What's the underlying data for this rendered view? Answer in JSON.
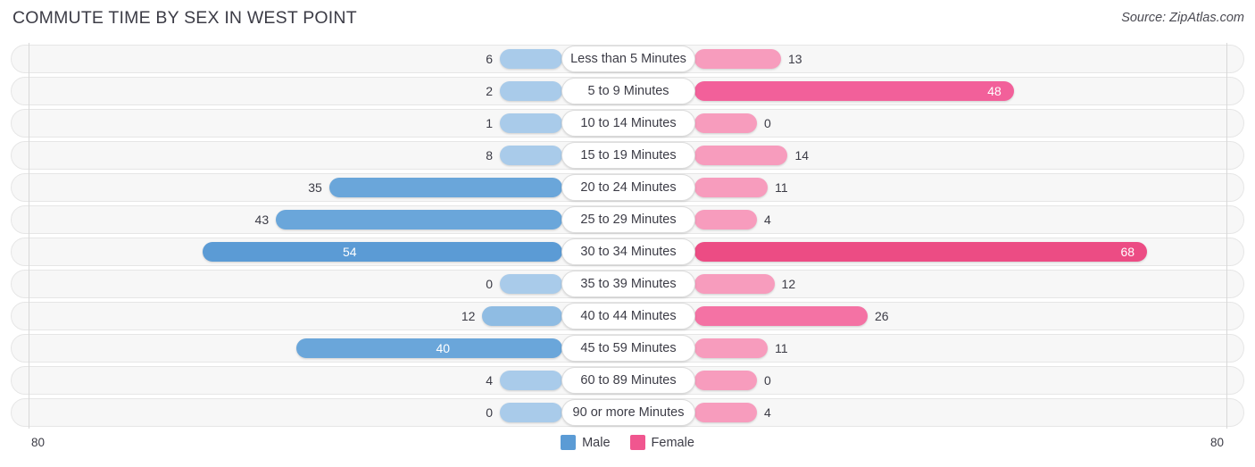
{
  "header": {
    "title": "COMMUTE TIME BY SEX IN WEST POINT",
    "source": "Source: ZipAtlas.com"
  },
  "footer": {
    "axis_left": "80",
    "axis_right": "80"
  },
  "legend": [
    {
      "label": "Male",
      "color": "#5b9bd5"
    },
    {
      "label": "Female",
      "color": "#f0568f"
    }
  ],
  "chart_data": {
    "type": "bar",
    "subtype": "diverging-bidirectional-bar",
    "title": "COMMUTE TIME BY SEX IN WEST POINT",
    "source": "Source: ZipAtlas.com",
    "xlabel": "",
    "ylabel": "",
    "xlim": [
      80,
      80
    ],
    "axis_left_max": 80,
    "axis_right_max": 80,
    "grid": false,
    "legend_position": "bottom-center",
    "categories": [
      "Less than 5 Minutes",
      "5 to 9 Minutes",
      "10 to 14 Minutes",
      "15 to 19 Minutes",
      "20 to 24 Minutes",
      "25 to 29 Minutes",
      "30 to 34 Minutes",
      "35 to 39 Minutes",
      "40 to 44 Minutes",
      "45 to 59 Minutes",
      "60 to 89 Minutes",
      "90 or more Minutes"
    ],
    "series": [
      {
        "name": "Male",
        "color": "#5b9bd5",
        "values": [
          6,
          2,
          1,
          8,
          35,
          43,
          54,
          0,
          12,
          40,
          4,
          0
        ]
      },
      {
        "name": "Female",
        "color": "#f0568f",
        "values": [
          13,
          48,
          0,
          14,
          11,
          4,
          68,
          12,
          26,
          11,
          0,
          4
        ]
      }
    ]
  },
  "rows": [
    {
      "label": "Less than 5 Minutes",
      "male": "6",
      "female": "13",
      "male_inside": false,
      "female_inside": false
    },
    {
      "label": "5 to 9 Minutes",
      "male": "2",
      "female": "48",
      "male_inside": false,
      "female_inside": true
    },
    {
      "label": "10 to 14 Minutes",
      "male": "1",
      "female": "0",
      "male_inside": false,
      "female_inside": false
    },
    {
      "label": "15 to 19 Minutes",
      "male": "8",
      "female": "14",
      "male_inside": false,
      "female_inside": false
    },
    {
      "label": "20 to 24 Minutes",
      "male": "35",
      "female": "11",
      "male_inside": false,
      "female_inside": false
    },
    {
      "label": "25 to 29 Minutes",
      "male": "43",
      "female": "4",
      "male_inside": false,
      "female_inside": false
    },
    {
      "label": "30 to 34 Minutes",
      "male": "54",
      "female": "68",
      "male_inside": true,
      "female_inside": true
    },
    {
      "label": "35 to 39 Minutes",
      "male": "0",
      "female": "12",
      "male_inside": false,
      "female_inside": false
    },
    {
      "label": "40 to 44 Minutes",
      "male": "12",
      "female": "26",
      "male_inside": false,
      "female_inside": false
    },
    {
      "label": "45 to 59 Minutes",
      "male": "40",
      "female": "11",
      "male_inside": true,
      "female_inside": false
    },
    {
      "label": "60 to 89 Minutes",
      "male": "4",
      "female": "0",
      "male_inside": false,
      "female_inside": false
    },
    {
      "label": "90 or more Minutes",
      "male": "0",
      "female": "4",
      "male_inside": false,
      "female_inside": false
    }
  ]
}
